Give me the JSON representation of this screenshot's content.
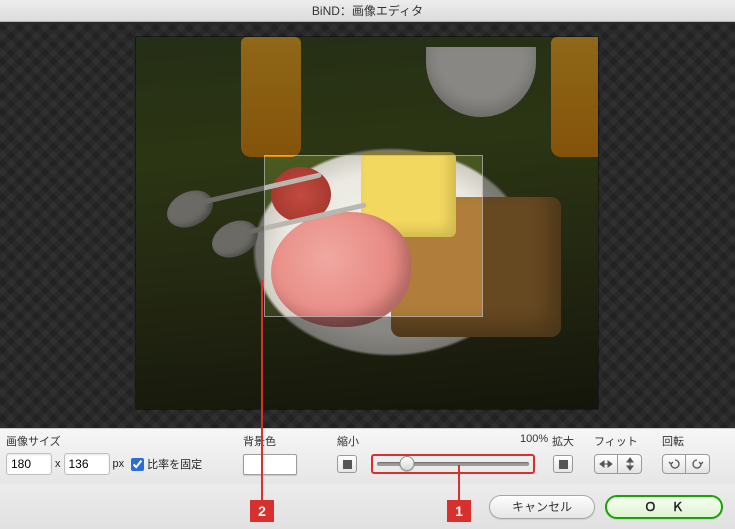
{
  "titlebar": {
    "title": "BiND：画像エディタ"
  },
  "labels": {
    "image_size": "画像サイズ",
    "bg_color": "背景色",
    "shrink": "縮小",
    "percent": "100%",
    "enlarge": "拡大",
    "fit": "フィット",
    "rotate": "回転",
    "px": "px",
    "x": "x",
    "lock_ratio": "比率を固定"
  },
  "size": {
    "width": "180",
    "height": "136"
  },
  "lock_ratio_checked": true,
  "bg_color_value": "#ffffff",
  "zoom": {
    "value_pct": 20,
    "label": "100%"
  },
  "buttons": {
    "cancel": "キャンセル",
    "ok": "Ｏ Ｋ"
  },
  "annotations": {
    "marker1": "1",
    "marker2": "2"
  }
}
